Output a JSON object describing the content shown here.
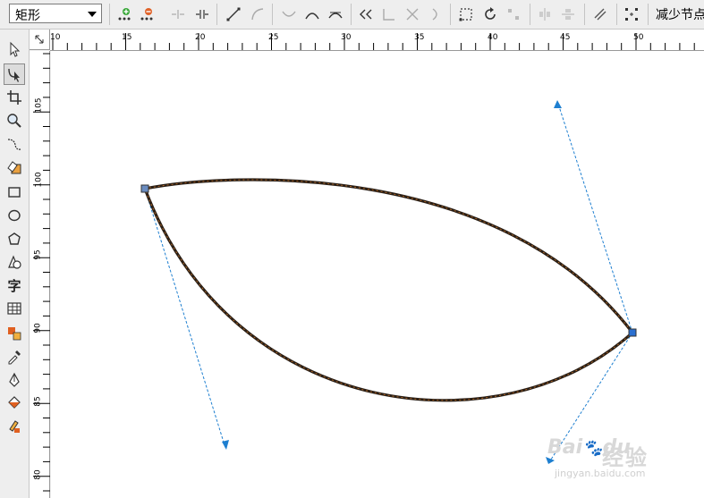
{
  "property_bar": {
    "shape_combo": {
      "value": "矩形"
    },
    "reduce_nodes_label": "减少节点"
  },
  "toolbar_icons": [
    "add-node-icon",
    "delete-node-icon",
    "join-nodes-icon",
    "break-curve-icon",
    "to-line-icon",
    "to-curve-icon",
    "cusp-node-icon",
    "smooth-node-icon",
    "symmetric-node-icon",
    "reverse-direction-icon",
    "extend-curve-icon",
    "extract-subpath-icon",
    "auto-close-icon",
    "stretch-nodes-icon",
    "rotate-nodes-icon",
    "align-nodes-icon",
    "reflect-h-icon",
    "reflect-v-icon",
    "elastic-mode-icon",
    "select-all-nodes-icon"
  ],
  "tools": [
    "pick-tool-icon",
    "shape-tool-icon",
    "crop-tool-icon",
    "zoom-tool-icon",
    "freehand-tool-icon",
    "smart-fill-tool-icon",
    "rectangle-tool-icon",
    "ellipse-tool-icon",
    "polygon-tool-icon",
    "basic-shapes-tool-icon",
    "text-tool-icon",
    "table-tool-icon",
    "blend-tool-icon",
    "eyedropper-tool-icon",
    "outline-pen-tool-icon",
    "fill-tool-icon",
    "interactive-fill-tool-icon"
  ],
  "rulers": {
    "horizontal_labels": [
      "10",
      "15",
      "20",
      "25",
      "30",
      "35",
      "40",
      "45",
      "50"
    ],
    "vertical_labels": [
      "105",
      "100",
      "95",
      "90",
      "85",
      "80"
    ]
  },
  "watermark": {
    "brand": "Bai",
    "brand_suffix": "du",
    "jingyan": "经验",
    "url": "jingyan.baidu.com"
  },
  "colors": {
    "curve": "#2a1f16",
    "curve_dash": "#c8742a",
    "handle": "#1e7fd0"
  }
}
